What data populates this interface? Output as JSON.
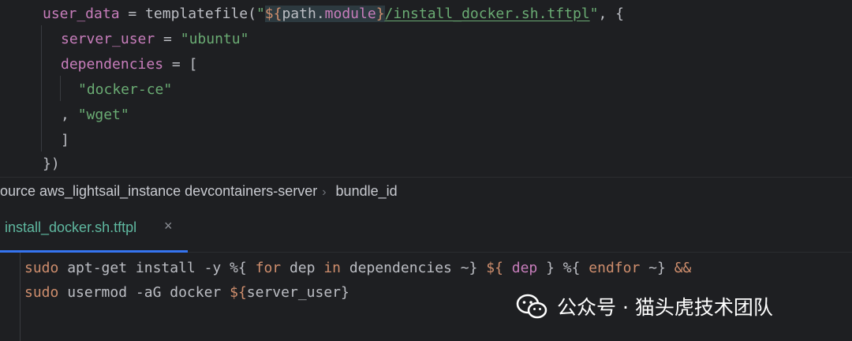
{
  "editor_top": {
    "lines": [
      [
        {
          "t": "user_data",
          "c": "tok-attr"
        },
        {
          "t": " = templatefile(",
          "c": "tok-plain"
        },
        {
          "t": "\"",
          "c": "tok-str"
        },
        {
          "t": "${",
          "c": "tok-interp tok-hl"
        },
        {
          "t": "path.",
          "c": "tok-interp-var tok-hl"
        },
        {
          "t": "module",
          "c": "tok-var-purple tok-hl"
        },
        {
          "t": "}",
          "c": "tok-interp tok-hl"
        },
        {
          "t": "/install_docker.sh.tftpl",
          "c": "tok-link"
        },
        {
          "t": "\"",
          "c": "tok-str"
        },
        {
          "t": ", {",
          "c": "tok-plain"
        }
      ],
      [
        {
          "t": "server_user",
          "c": "tok-attr"
        },
        {
          "t": " = ",
          "c": "tok-plain"
        },
        {
          "t": "\"ubuntu\"",
          "c": "tok-str"
        }
      ],
      [
        {
          "t": "dependencies",
          "c": "tok-attr"
        },
        {
          "t": " = [",
          "c": "tok-plain"
        }
      ],
      [
        {
          "t": "\"docker-ce\"",
          "c": "tok-str"
        }
      ],
      [
        {
          "t": ", ",
          "c": "tok-plain"
        },
        {
          "t": "\"wget\"",
          "c": "tok-str"
        }
      ],
      [
        {
          "t": "]",
          "c": "tok-plain"
        }
      ],
      [
        {
          "t": "})",
          "c": "tok-plain"
        }
      ]
    ]
  },
  "breadcrumb": {
    "items": [
      "ource aws_lightsail_instance devcontainers-server",
      "bundle_id"
    ],
    "separator": "›"
  },
  "tab": {
    "label": "install_docker.sh.tftpl",
    "close_glyph": "×",
    "active_color": "#3574f0"
  },
  "editor_bottom": {
    "lines": [
      [
        {
          "t": "sudo",
          "c": "tok-kw"
        },
        {
          "t": " apt-get install -y %{ ",
          "c": "tok-plain"
        },
        {
          "t": "for",
          "c": "tok-kw"
        },
        {
          "t": " dep ",
          "c": "tok-plain"
        },
        {
          "t": "in",
          "c": "tok-kw"
        },
        {
          "t": " dependencies ~} ",
          "c": "tok-plain"
        },
        {
          "t": "${ ",
          "c": "tok-kw"
        },
        {
          "t": "dep",
          "c": "tok-kw-var"
        },
        {
          "t": " } %{ ",
          "c": "tok-plain"
        },
        {
          "t": "endfor",
          "c": "tok-kw"
        },
        {
          "t": " ~} ",
          "c": "tok-plain"
        },
        {
          "t": "&&",
          "c": "tok-kw"
        }
      ],
      [
        {
          "t": "sudo",
          "c": "tok-kw"
        },
        {
          "t": " usermod -aG docker ",
          "c": "tok-plain"
        },
        {
          "t": "${",
          "c": "tok-kw"
        },
        {
          "t": "server_user}",
          "c": "tok-plain"
        }
      ]
    ]
  },
  "watermark": {
    "text": "公众号 · 猫头虎技术团队",
    "icon": "wechat-icon"
  }
}
